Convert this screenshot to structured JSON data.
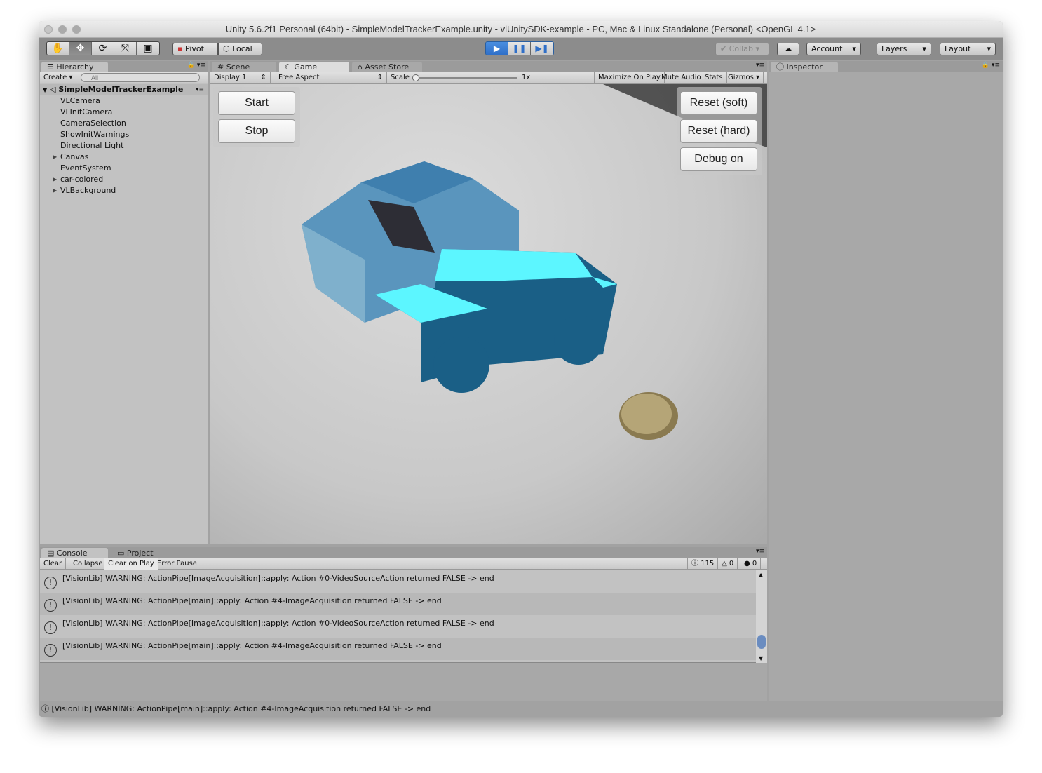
{
  "window": {
    "title": "Unity 5.6.2f1 Personal (64bit) - SimpleModelTrackerExample.unity - vlUnitySDK-example - PC, Mac & Linux Standalone (Personal) <OpenGL 4.1>"
  },
  "toolbar": {
    "tools": [
      "hand-icon",
      "move-icon",
      "rotate-icon",
      "scale-icon",
      "rect-icon"
    ],
    "pivot": "Pivot",
    "local": "Local",
    "collab": "Collab",
    "account": "Account",
    "layers": "Layers",
    "layout": "Layout"
  },
  "hierarchy": {
    "tab": "Hierarchy",
    "create": "Create",
    "search_placeholder": "All",
    "scene": "SimpleModelTrackerExample",
    "items": [
      {
        "label": "VLCamera",
        "expandable": false
      },
      {
        "label": "VLInitCamera",
        "expandable": false
      },
      {
        "label": "CameraSelection",
        "expandable": false
      },
      {
        "label": "ShowInitWarnings",
        "expandable": false
      },
      {
        "label": "Directional Light",
        "expandable": false
      },
      {
        "label": "Canvas",
        "expandable": true
      },
      {
        "label": "EventSystem",
        "expandable": false
      },
      {
        "label": "car-colored",
        "expandable": true
      },
      {
        "label": "VLBackground",
        "expandable": true
      }
    ]
  },
  "center": {
    "tabs": [
      "Scene",
      "Game",
      "Asset Store"
    ],
    "active_tab": "Game",
    "display": "Display 1",
    "aspect": "Free Aspect",
    "scale_label": "Scale",
    "scale_value": "1x",
    "maximize": "Maximize On Play",
    "mute": "Mute Audio",
    "stats": "Stats",
    "gizmos": "Gizmos"
  },
  "game": {
    "left_buttons": [
      "Start",
      "Stop"
    ],
    "right_buttons": [
      "Reset (soft)",
      "Reset (hard)",
      "Debug on"
    ],
    "overlay_color": "#1a5f86",
    "overlay_top_color": "#5cf6ff"
  },
  "inspector": {
    "tab": "Inspector"
  },
  "console": {
    "tabs": [
      "Console",
      "Project"
    ],
    "buttons": [
      "Clear",
      "Collapse",
      "Clear on Play",
      "Error Pause"
    ],
    "counts": {
      "info": "115",
      "warn": "0",
      "error": "0"
    },
    "messages": [
      "[VisionLib] WARNING: ActionPipe[ImageAcquisition]::apply: Action #0-VideoSourceAction returned FALSE -> end",
      "[VisionLib] WARNING: ActionPipe[main]::apply: Action #4-ImageAcquisition returned FALSE -> end",
      "[VisionLib] WARNING: ActionPipe[ImageAcquisition]::apply: Action #0-VideoSourceAction returned FALSE -> end",
      "[VisionLib] WARNING: ActionPipe[main]::apply: Action #4-ImageAcquisition returned FALSE -> end"
    ]
  },
  "status": {
    "message": "[VisionLib] WARNING: ActionPipe[main]::apply: Action #4-ImageAcquisition returned FALSE -> end"
  }
}
